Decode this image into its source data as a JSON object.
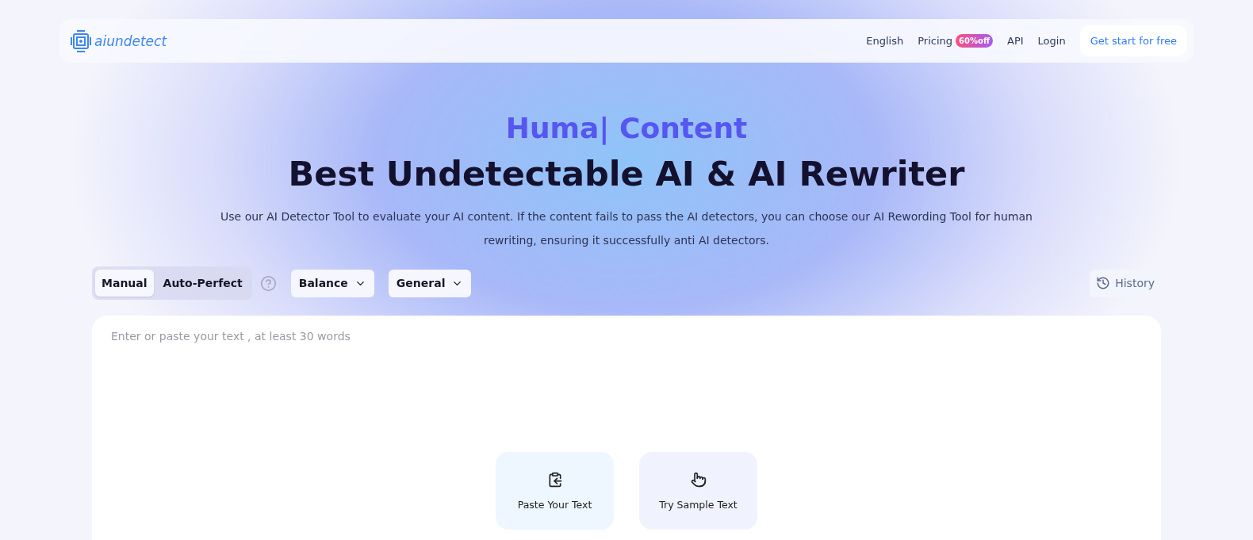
{
  "nav": {
    "logo": "aiundetect",
    "links": [
      {
        "label": "English",
        "kind": "link"
      },
      {
        "label": "Pricing",
        "kind": "badge-link",
        "badge": "60%off"
      },
      {
        "label": "API",
        "kind": "link"
      },
      {
        "label": "Login",
        "kind": "link"
      }
    ],
    "cta": "Get start for free"
  },
  "hero": {
    "typing": "Huma| Content",
    "title": "Best Undetectable AI & AI Rewriter",
    "subtitle": "Use our AI Detector Tool to evaluate your AI content. If the content fails to pass the AI detectors, you can choose our AI Rewording Tool for human rewriting, ensuring it successfully anti AI detectors."
  },
  "modes": [
    {
      "label": "Manual",
      "selected": true
    },
    {
      "label": "Auto-Perfect",
      "selected": false
    }
  ],
  "dropdowns": [
    "Balance",
    "General"
  ],
  "history": "History",
  "editor": {
    "placeholder": "Enter or paste your text , at least 30 words",
    "actions": [
      {
        "label": "Paste Your Text",
        "kind": "paste"
      },
      {
        "label": "Try Sample Text",
        "kind": "sample"
      }
    ]
  }
}
